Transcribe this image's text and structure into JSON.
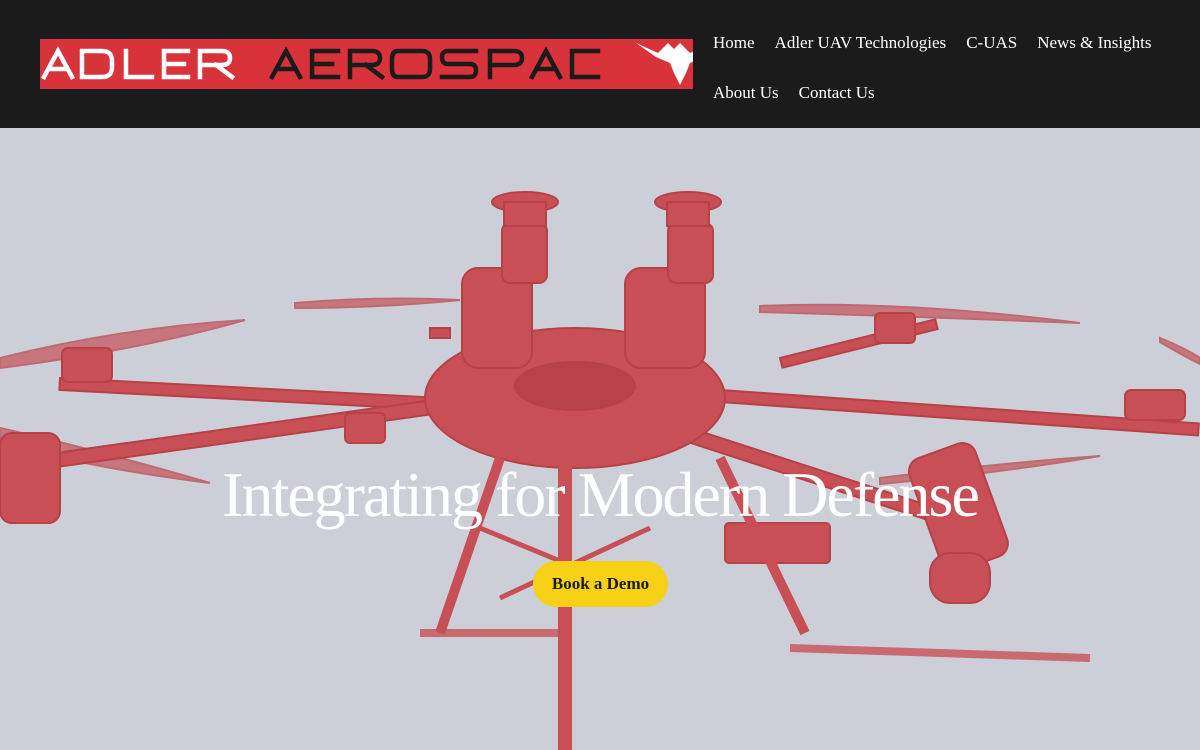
{
  "brand": {
    "logo_text": "ADLER AEROSPACE",
    "logo_color": "#d8333a"
  },
  "nav": {
    "row1": [
      {
        "label": "Home"
      },
      {
        "label": "Adler UAV Technologies"
      },
      {
        "label": "C-UAS"
      },
      {
        "label": "News & Insights"
      }
    ],
    "row2": [
      {
        "label": "About Us"
      },
      {
        "label": "Contact Us"
      }
    ]
  },
  "hero": {
    "title": "Integrating for Modern Defense",
    "cta_label": "Book a Demo",
    "cta_color": "#f7d117",
    "image_icon": "octocopter-drone-photo"
  }
}
